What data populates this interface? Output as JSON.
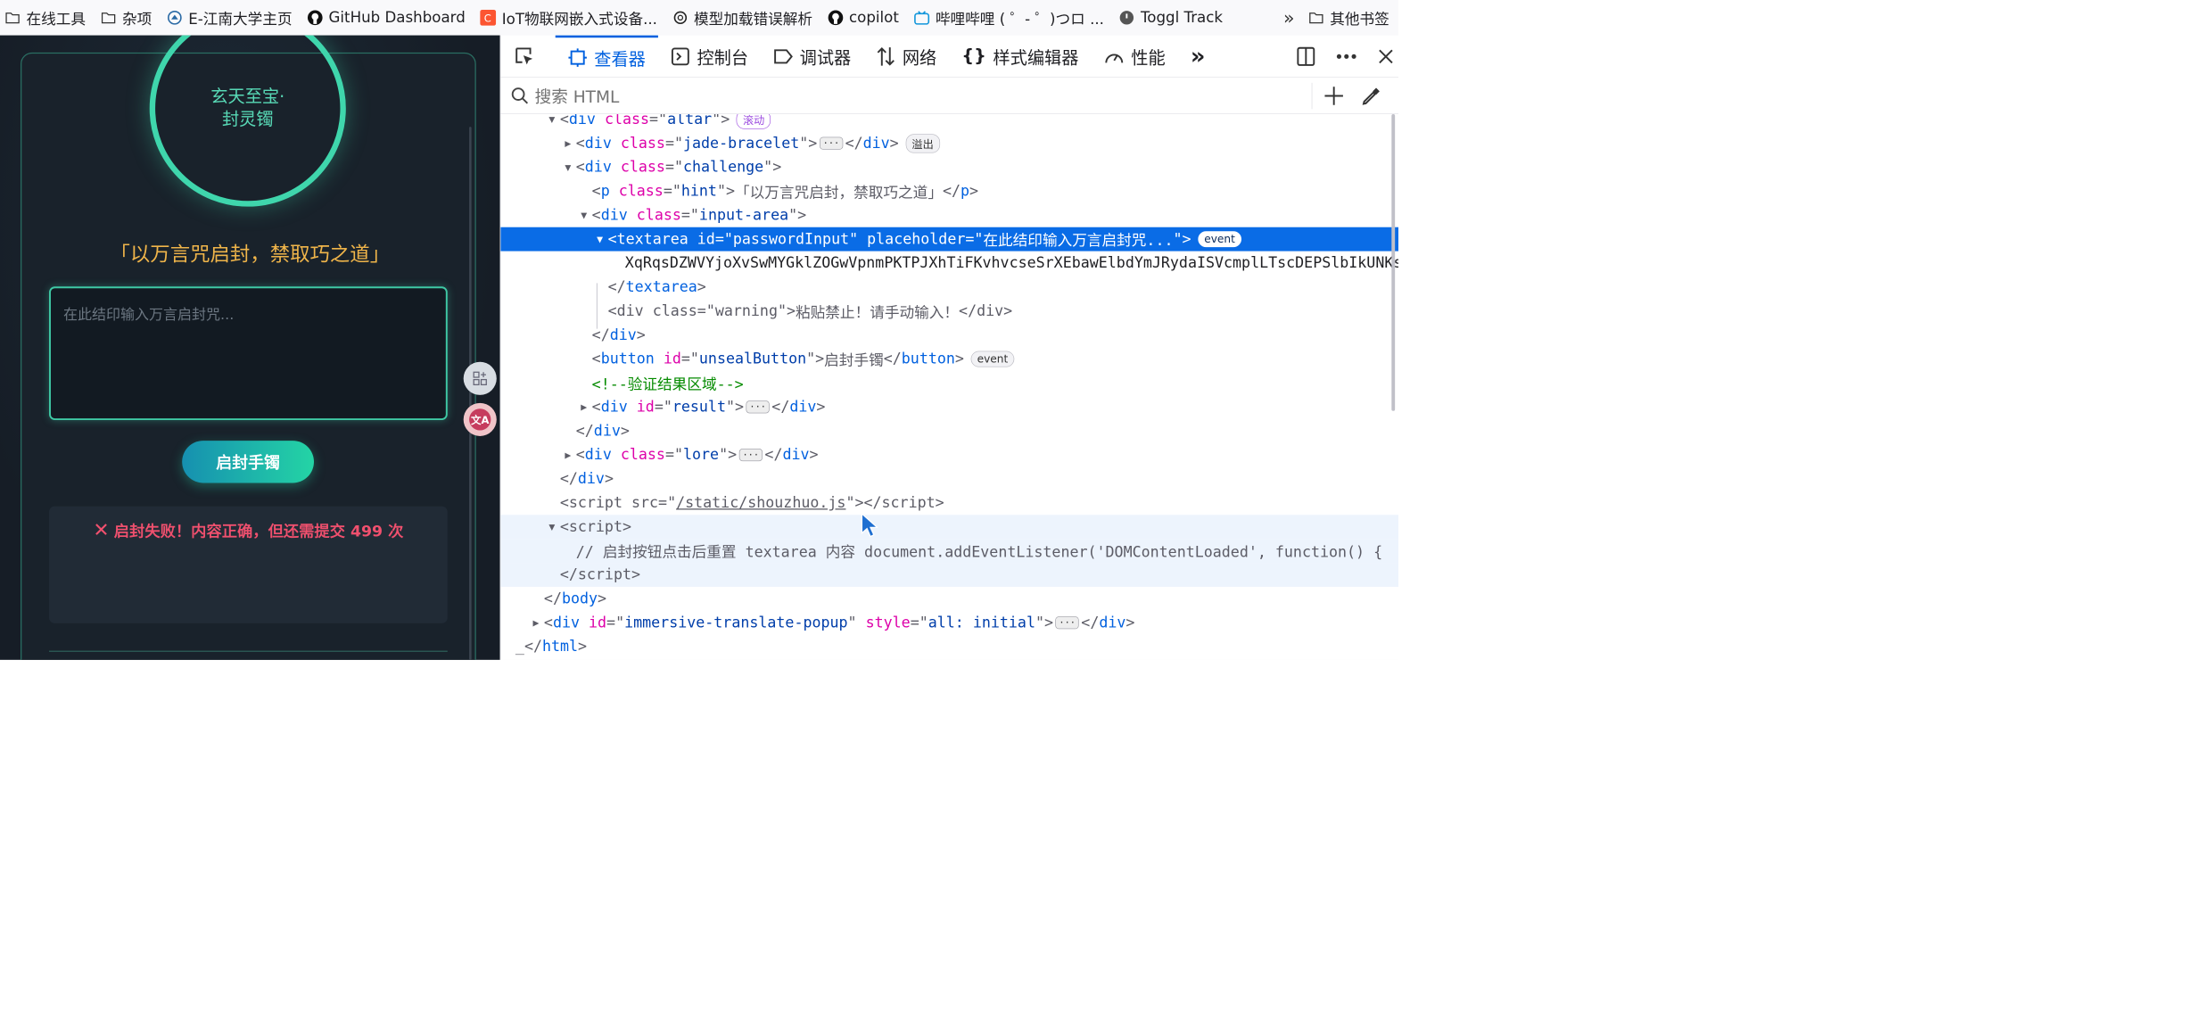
{
  "bookmarks": {
    "items": [
      {
        "label": "在线工具",
        "icon": "folder-icon"
      },
      {
        "label": "杂项",
        "icon": "folder-icon"
      },
      {
        "label": "E-江南大学主页",
        "icon": "university-icon"
      },
      {
        "label": "GitHub Dashboard",
        "icon": "github-icon"
      },
      {
        "label": "IoT物联网嵌入式设备...",
        "icon": "csdn-icon"
      },
      {
        "label": "模型加载错误解析",
        "icon": "openai-icon"
      },
      {
        "label": "copilot",
        "icon": "github-icon"
      },
      {
        "label": "哔哩哔哩 ( ゜- ゜)つロ ...",
        "icon": "bilibili-icon"
      },
      {
        "label": "Toggl Track",
        "icon": "toggl-icon"
      }
    ],
    "overflow_icon": "chevron-double-right-icon",
    "other": "其他书签"
  },
  "page": {
    "ring_line1": "玄天至宝·",
    "ring_line2": "封灵镯",
    "hint": "「以万言咒启封，禁取巧之道」",
    "textarea_placeholder": "在此结印输入万言启封咒...",
    "button": "启封手镯",
    "result_icon": "✕",
    "result": "启封失败！内容正确，但还需提交 499 次"
  },
  "devtools": {
    "tabs": [
      {
        "label": "查看器",
        "icon": "inspector-icon",
        "active": true
      },
      {
        "label": "控制台",
        "icon": "console-icon"
      },
      {
        "label": "调试器",
        "icon": "debugger-icon"
      },
      {
        "label": "网络",
        "icon": "network-icon"
      },
      {
        "label": "样式编辑器",
        "icon": "style-editor-icon"
      },
      {
        "label": "性能",
        "icon": "performance-icon"
      }
    ],
    "search_placeholder": "搜索 HTML",
    "tree": {
      "l1": {
        "tag": "div",
        "attr": "class",
        "val": "altar",
        "badge": "滚动"
      },
      "l2": {
        "tag": "div",
        "attr": "class",
        "val": "jade-bracelet",
        "badge": "溢出"
      },
      "l3": {
        "tag": "div",
        "attr": "class",
        "val": "challenge"
      },
      "l4": {
        "tag": "p",
        "attr": "class",
        "val": "hint",
        "text": "「以万言咒启封，禁取巧之道」"
      },
      "l5": {
        "tag": "div",
        "attr": "class",
        "val": "input-area"
      },
      "l6": {
        "tag": "textarea",
        "attr1": "id",
        "val1": "passwordInput",
        "attr2": "placeholder",
        "val2": "在此结印输入万言启封咒...",
        "badge": "event"
      },
      "l7": {
        "text": "XqRqsDZWVYjoXvSwMYGklZOGwVpnmPKTPJXhTiFKvhvcseSrXEbawElbdYmJRydaISVcmplLTscDEPSlbIkUNKs"
      },
      "l8": {
        "tag": "textarea"
      },
      "l9": {
        "tag": "div",
        "attr": "class",
        "val": "warning",
        "text": "粘贴禁止！请手动输入！"
      },
      "l10": {
        "tag": "div"
      },
      "l11": {
        "tag": "button",
        "attr": "id",
        "val": "unsealButton",
        "text": "启封手镯",
        "badge": "event"
      },
      "l12": {
        "comment": "<!--验证结果区域-->"
      },
      "l13": {
        "tag": "div",
        "attr": "id",
        "val": "result"
      },
      "l14": {
        "tag": "div"
      },
      "l15": {
        "tag": "div",
        "attr": "class",
        "val": "lore"
      },
      "l16": {
        "tag": "div"
      },
      "l17": {
        "tag": "script",
        "attr": "src",
        "val": "/static/shouzhuo.js"
      },
      "l18": {
        "tag": "script"
      },
      "l19": {
        "text": "// 启封按钮点击后重置 textarea 内容 document.addEventListener('DOMContentLoaded', function() {"
      },
      "l20": {
        "tag": "script"
      },
      "l21": {
        "tag": "body"
      },
      "l22": {
        "tag": "div",
        "attr1": "id",
        "val1": "immersive-translate-popup",
        "attr2": "style",
        "val2": "all: initial"
      },
      "l23": {
        "tag": "html"
      }
    }
  }
}
